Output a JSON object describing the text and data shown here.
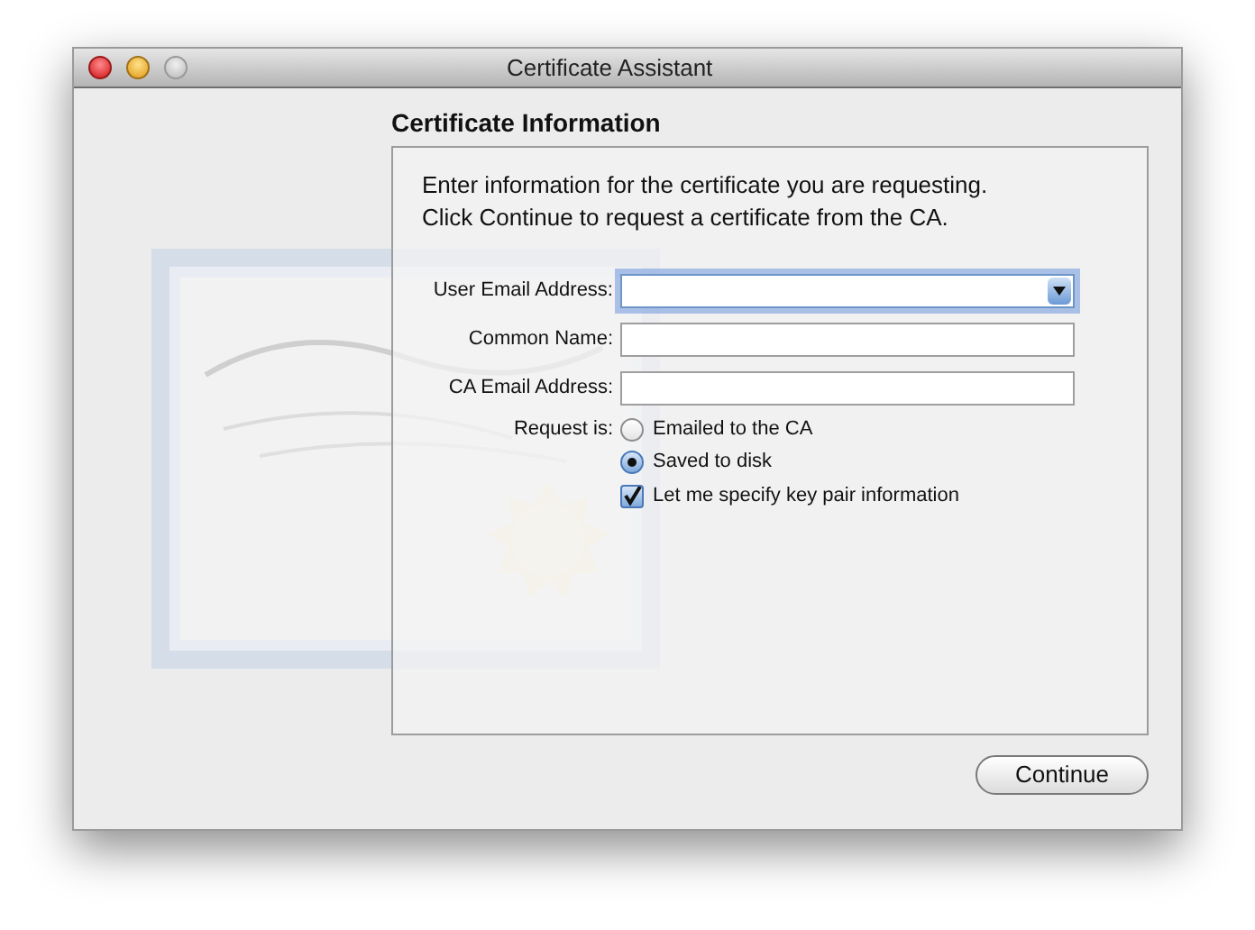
{
  "window": {
    "title": "Certificate Assistant",
    "controls": [
      {
        "kind": "close",
        "disabled": false
      },
      {
        "kind": "minimize",
        "disabled": false
      },
      {
        "kind": "zoom",
        "disabled": true
      }
    ]
  },
  "heading": "Certificate Information",
  "intro": [
    "Enter information for the certificate you are requesting.",
    "Click Continue to request a certificate from the CA."
  ],
  "fields": [
    {
      "label": "User Email Address:",
      "kind": "combo",
      "focused": true
    },
    {
      "label": "Common Name:",
      "kind": "text",
      "focused": false
    },
    {
      "label": "CA Email Address:",
      "kind": "text",
      "focused": false
    }
  ],
  "request": {
    "label": "Request is:",
    "options": [
      {
        "label": "Emailed to the CA",
        "selected": false
      },
      {
        "label": "Saved to disk",
        "selected": true
      }
    ]
  },
  "key_pair": {
    "label": "Let me specify key pair information",
    "checked": true
  },
  "buttons": [
    "Continue"
  ]
}
